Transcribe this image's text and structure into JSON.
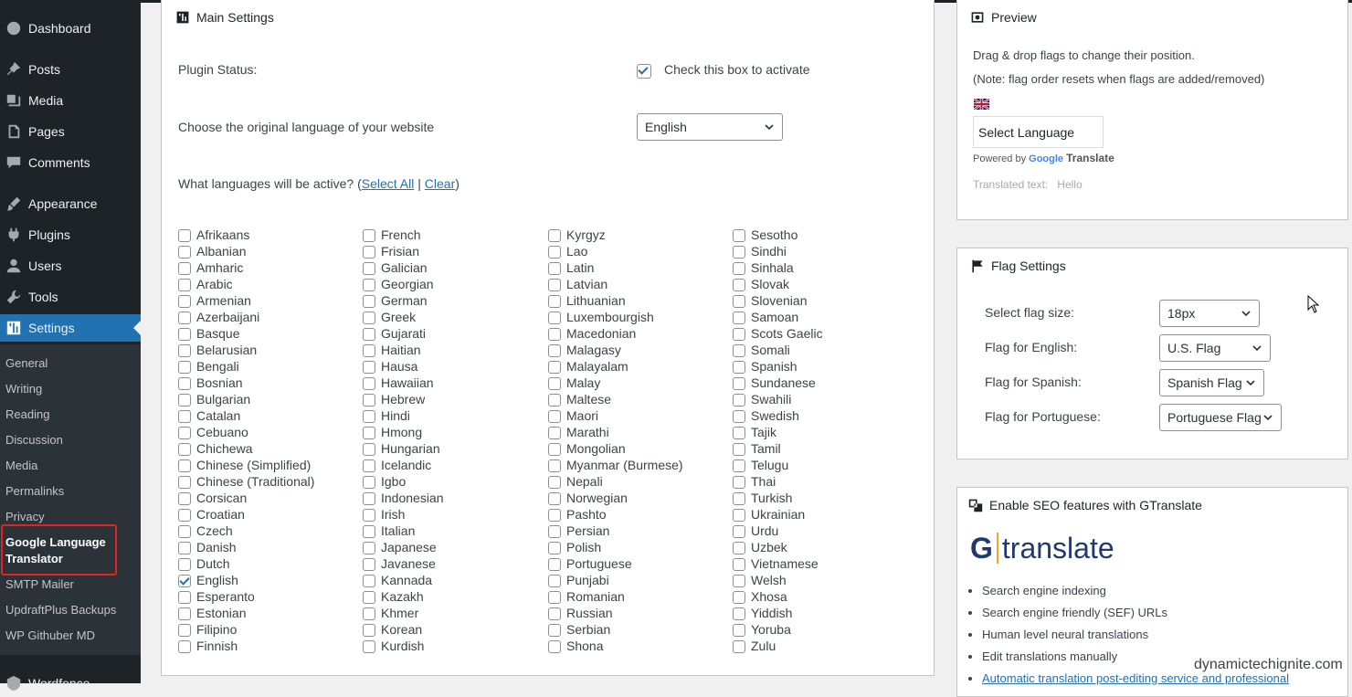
{
  "sidebar": {
    "items": [
      {
        "label": "Dashboard",
        "icon": "dashboard-icon"
      },
      {
        "label": "Posts",
        "icon": "pin-icon"
      },
      {
        "label": "Media",
        "icon": "media-icon"
      },
      {
        "label": "Pages",
        "icon": "pages-icon"
      },
      {
        "label": "Comments",
        "icon": "comment-icon"
      },
      {
        "label": "Appearance",
        "icon": "brush-icon"
      },
      {
        "label": "Plugins",
        "icon": "plugin-icon"
      },
      {
        "label": "Users",
        "icon": "user-icon"
      },
      {
        "label": "Tools",
        "icon": "wrench-icon"
      },
      {
        "label": "Settings",
        "icon": "settings-icon"
      }
    ],
    "submenu": [
      "General",
      "Writing",
      "Reading",
      "Discussion",
      "Media",
      "Permalinks",
      "Privacy",
      "Google Language Translator",
      "SMTP Mailer",
      "UpdraftPlus Backups",
      "WP Githuber MD"
    ],
    "bottom_item": {
      "label": "Wordfence",
      "icon": "wordfence-icon"
    }
  },
  "main": {
    "title": "Main Settings",
    "plugin_status_label": "Plugin Status:",
    "activate_label": "Check this box to activate",
    "original_lang_label": "Choose the original language of your website",
    "original_lang_value": "English",
    "active_langs_prefix": "What languages will be active? (",
    "select_all": "Select All",
    "separator": " | ",
    "clear": "Clear",
    "active_langs_suffix": ")",
    "languages": [
      [
        "Afrikaans",
        "Albanian",
        "Amharic",
        "Arabic",
        "Armenian",
        "Azerbaijani",
        "Basque",
        "Belarusian",
        "Bengali",
        "Bosnian",
        "Bulgarian",
        "Catalan",
        "Cebuano",
        "Chichewa",
        "Chinese (Simplified)",
        "Chinese (Traditional)",
        "Corsican",
        "Croatian",
        "Czech",
        "Danish",
        "Dutch",
        "English",
        "Esperanto",
        "Estonian",
        "Filipino",
        "Finnish"
      ],
      [
        "French",
        "Frisian",
        "Galician",
        "Georgian",
        "German",
        "Greek",
        "Gujarati",
        "Haitian",
        "Hausa",
        "Hawaiian",
        "Hebrew",
        "Hindi",
        "Hmong",
        "Hungarian",
        "Icelandic",
        "Igbo",
        "Indonesian",
        "Irish",
        "Italian",
        "Japanese",
        "Javanese",
        "Kannada",
        "Kazakh",
        "Khmer",
        "Korean",
        "Kurdish"
      ],
      [
        "Kyrgyz",
        "Lao",
        "Latin",
        "Latvian",
        "Lithuanian",
        "Luxembourgish",
        "Macedonian",
        "Malagasy",
        "Malayalam",
        "Malay",
        "Maltese",
        "Maori",
        "Marathi",
        "Mongolian",
        "Myanmar (Burmese)",
        "Nepali",
        "Norwegian",
        "Pashto",
        "Persian",
        "Polish",
        "Portuguese",
        "Punjabi",
        "Romanian",
        "Russian",
        "Serbian",
        "Shona"
      ],
      [
        "Sesotho",
        "Sindhi",
        "Sinhala",
        "Slovak",
        "Slovenian",
        "Samoan",
        "Scots Gaelic",
        "Somali",
        "Spanish",
        "Sundanese",
        "Swahili",
        "Swedish",
        "Tajik",
        "Tamil",
        "Telugu",
        "Thai",
        "Turkish",
        "Ukrainian",
        "Urdu",
        "Uzbek",
        "Vietnamese",
        "Welsh",
        "Xhosa",
        "Yiddish",
        "Yoruba",
        "Zulu"
      ]
    ],
    "checked": [
      "English"
    ]
  },
  "preview": {
    "title": "Preview",
    "line1": "Drag & drop flags to change their position.",
    "line2": "(Note: flag order resets when flags are added/removed)",
    "select_language": "Select Language",
    "powered_by": "Powered by",
    "google": "Google",
    "translate": "Translate",
    "translated_label": "Translated text:",
    "translated_value": "Hello"
  },
  "flags": {
    "title": "Flag Settings",
    "rows": [
      {
        "label": "Select flag size:",
        "value": "18px"
      },
      {
        "label": "Flag for English:",
        "value": "U.S. Flag"
      },
      {
        "label": "Flag for Spanish:",
        "value": "Spanish Flag"
      },
      {
        "label": "Flag for Portuguese:",
        "value": "Portuguese Flag"
      }
    ]
  },
  "seo": {
    "title": "Enable SEO features with GTranslate",
    "logo_g": "G",
    "logo_text": "translate",
    "items": [
      "Search engine indexing",
      "Search engine friendly (SEF) URLs",
      "Human level neural translations",
      "Edit translations manually"
    ],
    "link": "Automatic translation post-editing service and professional"
  },
  "watermark": "dynamictechignite.com",
  "colors": {
    "accent": "#2271b1",
    "sidebar": "#1d2327",
    "highlight": "#e02424"
  }
}
